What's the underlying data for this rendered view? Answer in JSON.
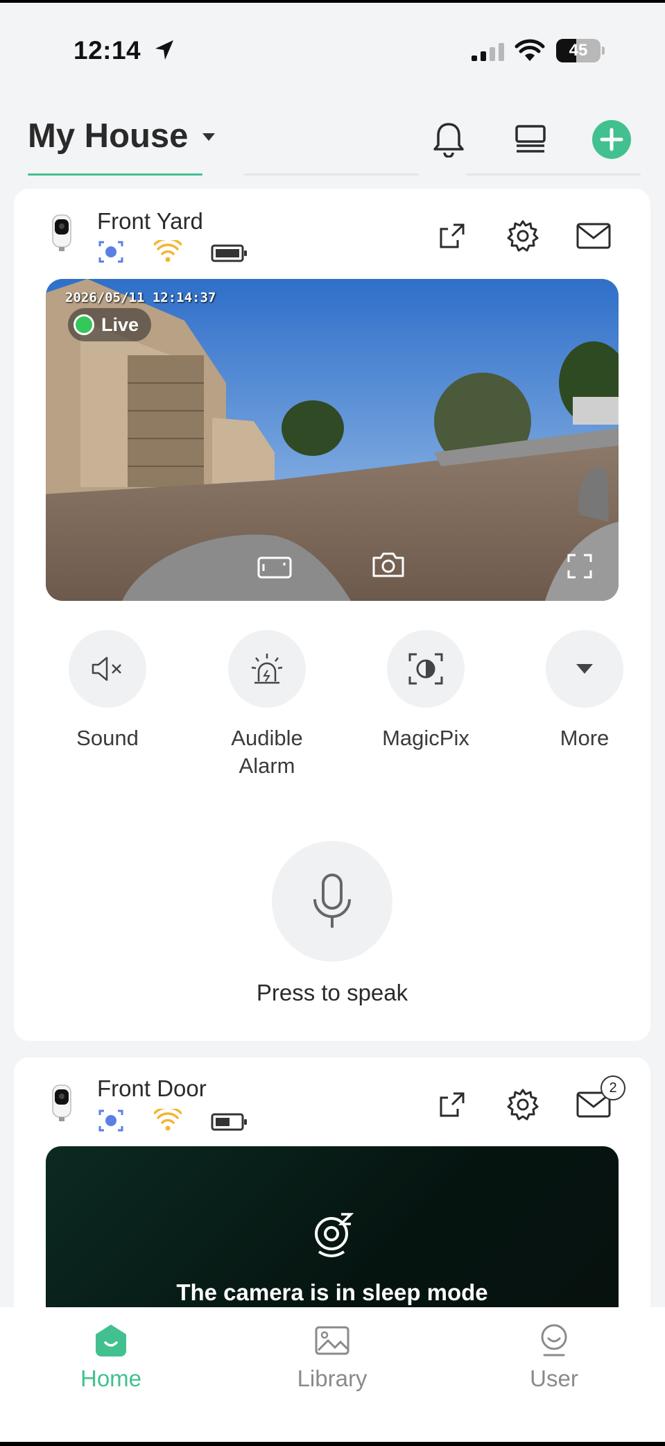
{
  "status_bar": {
    "time": "12:14",
    "battery": "45",
    "battery_level": 0.45
  },
  "header": {
    "title": "My House"
  },
  "colors": {
    "accent": "#43c08f",
    "status_blue": "#5b7fe3",
    "wifi_yellow": "#f2b531"
  },
  "cameras": [
    {
      "name": "Front Yard",
      "timestamp": "2026/05/11 12:14:37",
      "live_label": "Live",
      "controls": [
        {
          "label": "Sound",
          "icon": "speaker-muted-icon"
        },
        {
          "label": "Audible\nAlarm",
          "icon": "siren-icon"
        },
        {
          "label": "MagicPix",
          "icon": "magicpix-icon"
        },
        {
          "label": "More",
          "icon": "caret-down-icon"
        }
      ],
      "speak_label": "Press to speak"
    },
    {
      "name": "Front Door",
      "message_count": "2",
      "sleep_text": "The camera is in sleep mode"
    }
  ],
  "nav": {
    "home": "Home",
    "library": "Library",
    "user": "User"
  }
}
